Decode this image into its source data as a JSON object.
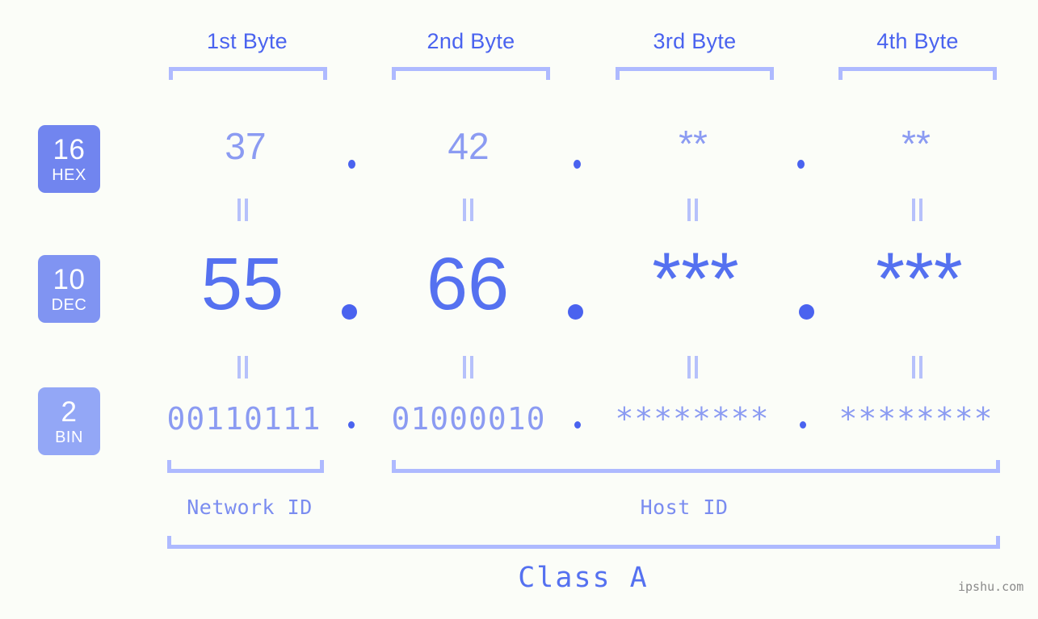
{
  "meta": {
    "background": "#fbfdf8",
    "accent_strong": "#4a63ef",
    "accent_mid": "#5571f0",
    "accent_soft": "#8b9bf2",
    "accent_light": "#aebaff",
    "watermark": "ipshu.com"
  },
  "headers": [
    {
      "label": "1st Byte"
    },
    {
      "label": "2nd Byte"
    },
    {
      "label": "3rd Byte"
    },
    {
      "label": "4th Byte"
    }
  ],
  "bases": [
    {
      "num": "16",
      "label": "HEX",
      "color": "#7185ef"
    },
    {
      "num": "10",
      "label": "DEC",
      "color": "#8094f2"
    },
    {
      "num": "2",
      "label": "BIN",
      "color": "#93a7f6"
    }
  ],
  "rows": {
    "hex": {
      "values": [
        "37",
        "42",
        "**",
        "**"
      ],
      "separator": "."
    },
    "dec": {
      "values": [
        "55",
        "66",
        "***",
        "***"
      ],
      "separator": "."
    },
    "bin": {
      "values": [
        "00110111",
        "01000010",
        "********",
        "********"
      ],
      "separator": "."
    }
  },
  "equals_marks": {
    "symbol": "=",
    "count": 8
  },
  "footer": {
    "network_id": "Network ID",
    "host_id": "Host ID",
    "class": "Class A"
  }
}
